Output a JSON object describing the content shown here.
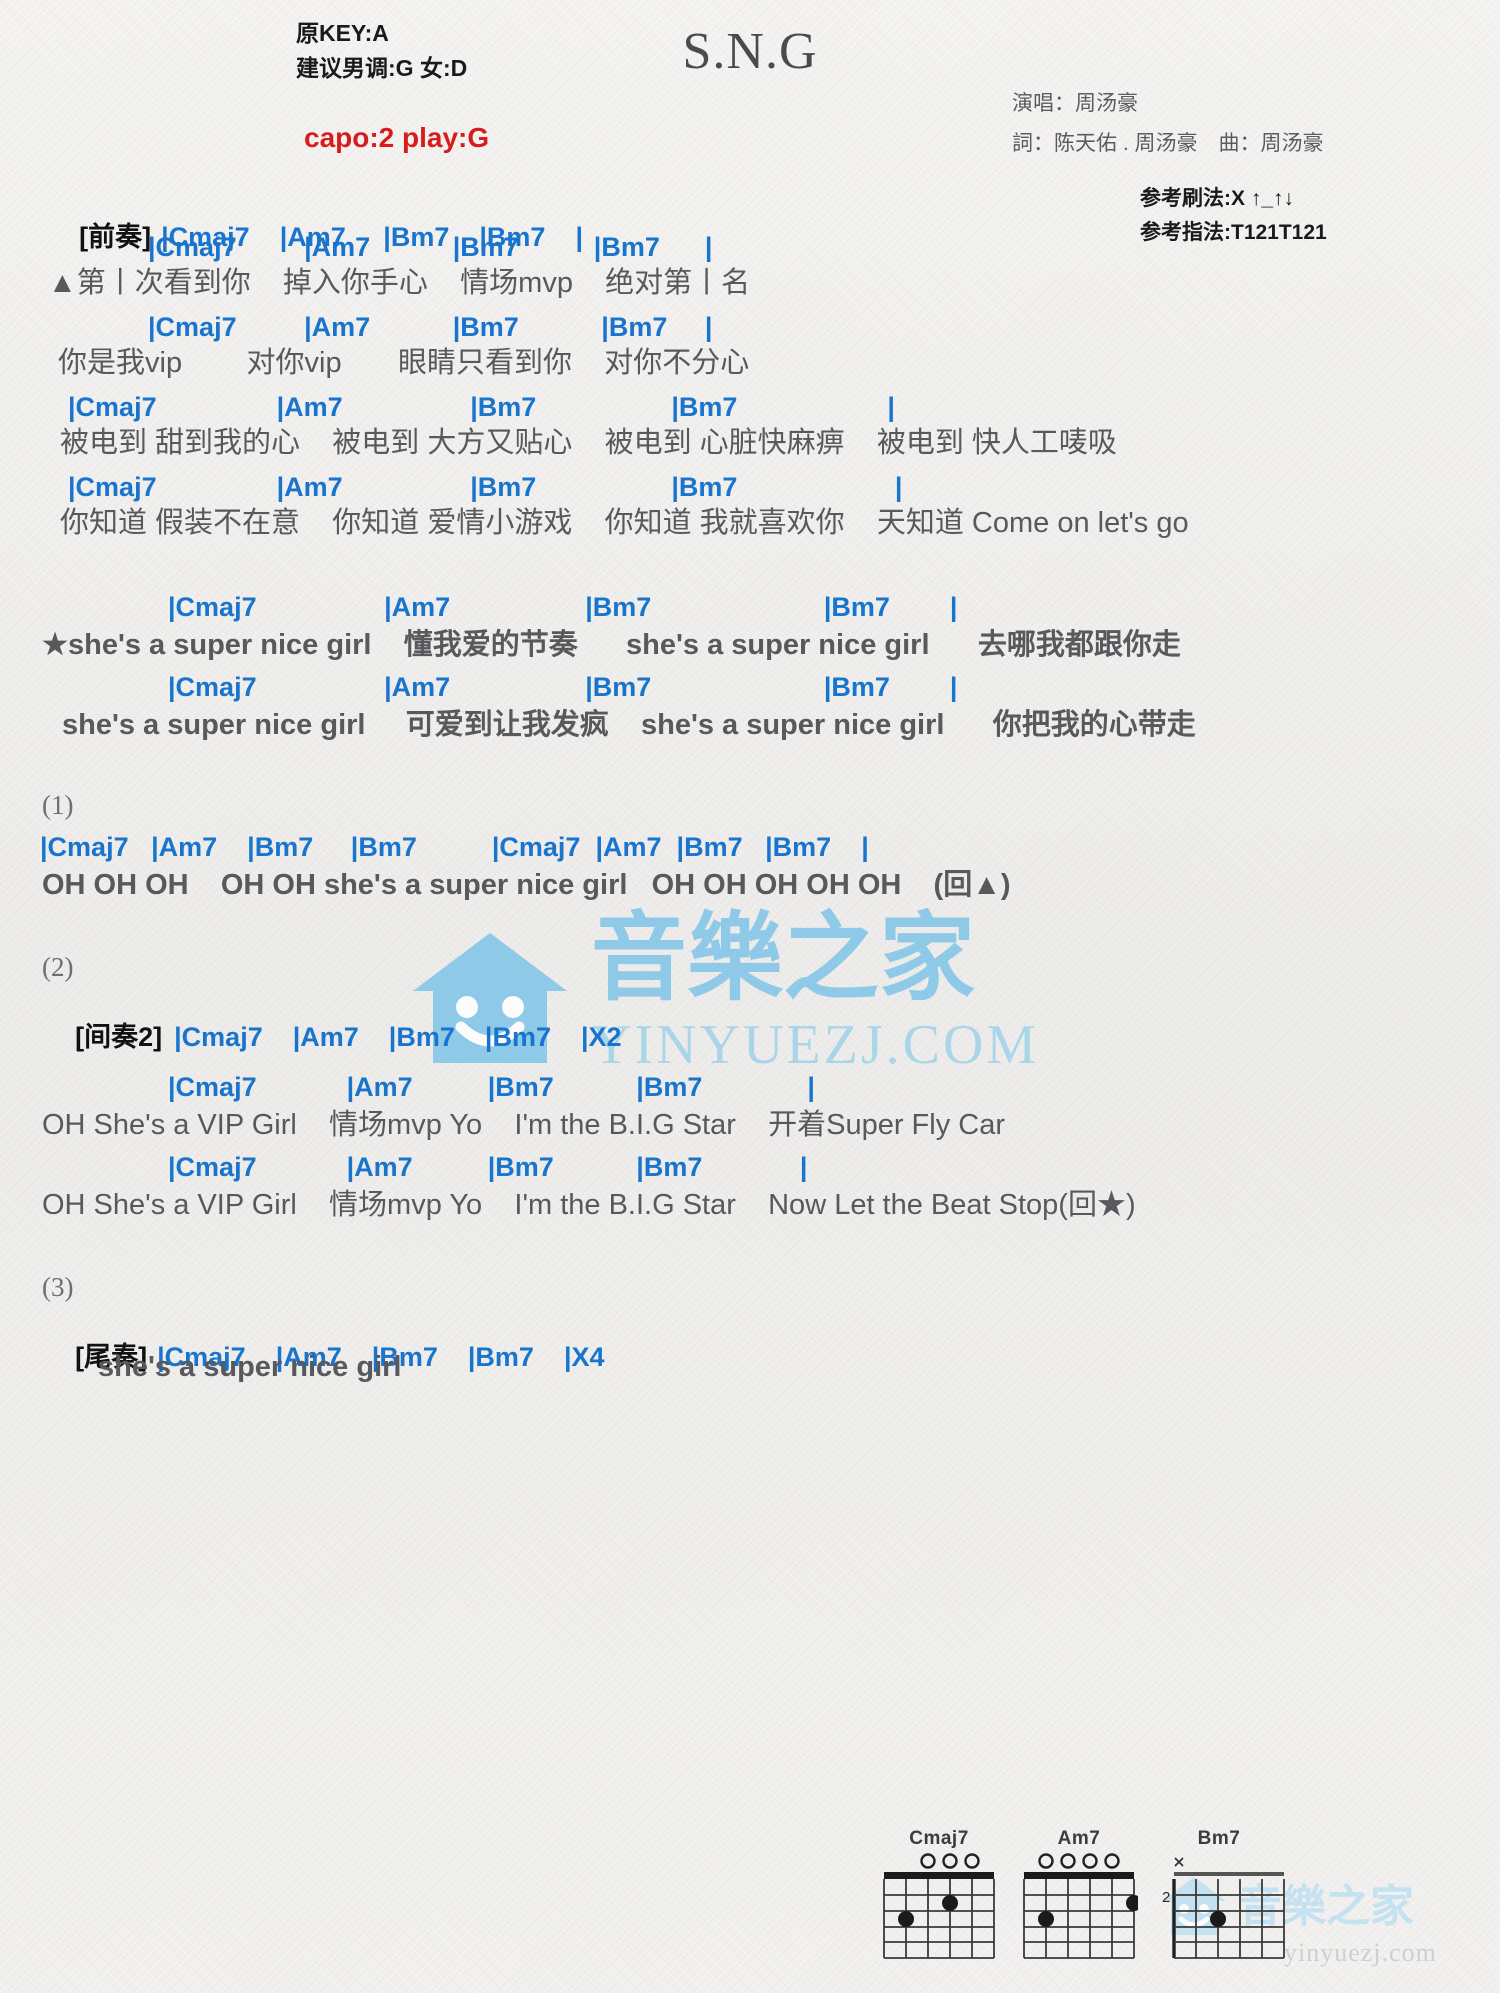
{
  "header": {
    "original_key": "原KEY:A",
    "suggested_key": "建议男调:G 女:D",
    "capo": "capo:2 play:G",
    "title": "S.N.G",
    "singer": "演唱：周汤豪",
    "writers": "詞：陈天佑 . 周汤豪　曲：周汤豪",
    "strum_ref": "参考刷法:X ↑_↑↓",
    "fingering_ref": "参考指法:T121T121"
  },
  "intro": {
    "tag": "[前奏]",
    "chords": "|Cmaj7    |Am7     |Bm7    |Bm7    |"
  },
  "verse1": {
    "rows": [
      {
        "chords": "|Cmaj7         |Am7           |Bm7          |Bm7      |",
        "lyrics": "▲第丨次看到你    掉入你手心    情场mvp    绝对第丨名"
      },
      {
        "chords": "|Cmaj7         |Am7           |Bm7           |Bm7     |",
        "lyrics": "你是我vip        对你vip       眼睛只看到你    对你不分心"
      }
    ]
  },
  "verse2": {
    "rows": [
      {
        "chords": "|Cmaj7                |Am7                 |Bm7                  |Bm7                    |",
        "lyrics": "被电到 甜到我的心    被电到 大方又贴心    被电到 心脏快麻痹    被电到 快人工唛吸"
      },
      {
        "chords": "|Cmaj7                |Am7                 |Bm7                  |Bm7                     |",
        "lyrics": "你知道 假装不在意    你知道 爱情小游戏    你知道 我就喜欢你    天知道 Come on let's go"
      }
    ]
  },
  "chorus": {
    "rows": [
      {
        "chords": "|Cmaj7                 |Am7                  |Bm7                       |Bm7        |",
        "lyrics": "★she's a super nice girl    懂我爱的节奏      she's a super nice girl      去哪我都跟你走"
      },
      {
        "chords": "|Cmaj7                 |Am7                  |Bm7                       |Bm7        |",
        "lyrics": "she's a super nice girl     可爱到让我发疯    she's a super nice girl      你把我的心带走"
      }
    ]
  },
  "ending1": {
    "num": "(1)",
    "chords": "|Cmaj7   |Am7    |Bm7     |Bm7          |Cmaj7  |Am7  |Bm7   |Bm7    |",
    "lyrics": "OH OH OH    OH OH she's a super nice girl   OH OH OH OH OH    (回▲)"
  },
  "interlude2": {
    "num": "(2)",
    "tag": "[间奏2]",
    "chords": "|Cmaj7    |Am7    |Bm7    |Bm7    |X2"
  },
  "bridge": {
    "rows": [
      {
        "chords": "|Cmaj7            |Am7          |Bm7           |Bm7              |",
        "lyrics": "OH She's a VIP Girl    情场mvp Yo    I'm the B.I.G Star    开着Super Fly Car"
      },
      {
        "chords": "|Cmaj7            |Am7          |Bm7           |Bm7             |",
        "lyrics": "OH She's a VIP Girl    情场mvp Yo    I'm the B.I.G Star    Now Let the Beat Stop(回★)"
      }
    ]
  },
  "outro": {
    "num": "(3)",
    "tag": "[尾奏]",
    "chords": "|Cmaj7    |Am7    |Bm7    |Bm7    |X4",
    "lyrics": "she's a super nice girl"
  },
  "diagrams": [
    {
      "name": "Cmaj7",
      "base_fret": "",
      "open_strings": [
        3,
        4,
        5
      ],
      "dots": [
        {
          "string": 2,
          "fret": 2
        },
        {
          "string": 1,
          "fret": 3
        }
      ]
    },
    {
      "name": "Am7",
      "base_fret": "",
      "open_strings": [
        2,
        3,
        4,
        5
      ],
      "dots": [
        {
          "string": 1,
          "fret": 2
        },
        {
          "string": 5,
          "fret": 3
        }
      ]
    },
    {
      "name": "Bm7",
      "base_fret": "2",
      "open_strings": [],
      "dots": [
        {
          "string": 2,
          "fret": 2
        }
      ]
    }
  ],
  "watermark": {
    "brand_cn": "音樂之家",
    "brand_en": "YINYUEZJ.COM",
    "footer_en": "yinyuezj.com"
  },
  "colors": {
    "chord_blue": "#1874cd",
    "bar_gold": "#b8860b",
    "capo_red": "#d81c1c",
    "lyric_gray": "#58585d",
    "watermark_blue": "#7fc4e8"
  }
}
